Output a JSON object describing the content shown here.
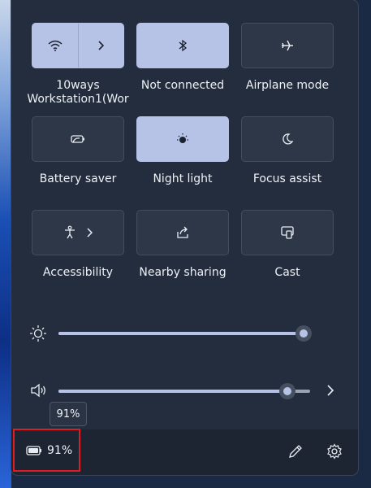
{
  "tiles": {
    "wifi": {
      "label": "10ways Workstation1(Wor"
    },
    "bluetooth": {
      "label": "Not connected"
    },
    "airplane": {
      "label": "Airplane mode"
    },
    "battery_saver": {
      "label": "Battery saver"
    },
    "night_light": {
      "label": "Night light"
    },
    "focus_assist": {
      "label": "Focus assist"
    },
    "accessibility": {
      "label": "Accessibility"
    },
    "nearby_sharing": {
      "label": "Nearby sharing"
    },
    "cast": {
      "label": "Cast"
    }
  },
  "brightness": {
    "value": 100
  },
  "volume": {
    "value": 91,
    "tooltip": "91%"
  },
  "footer": {
    "battery_text": "91%"
  },
  "colors": {
    "accent": "#b7c3e6",
    "highlight_box": "#e11b22"
  }
}
